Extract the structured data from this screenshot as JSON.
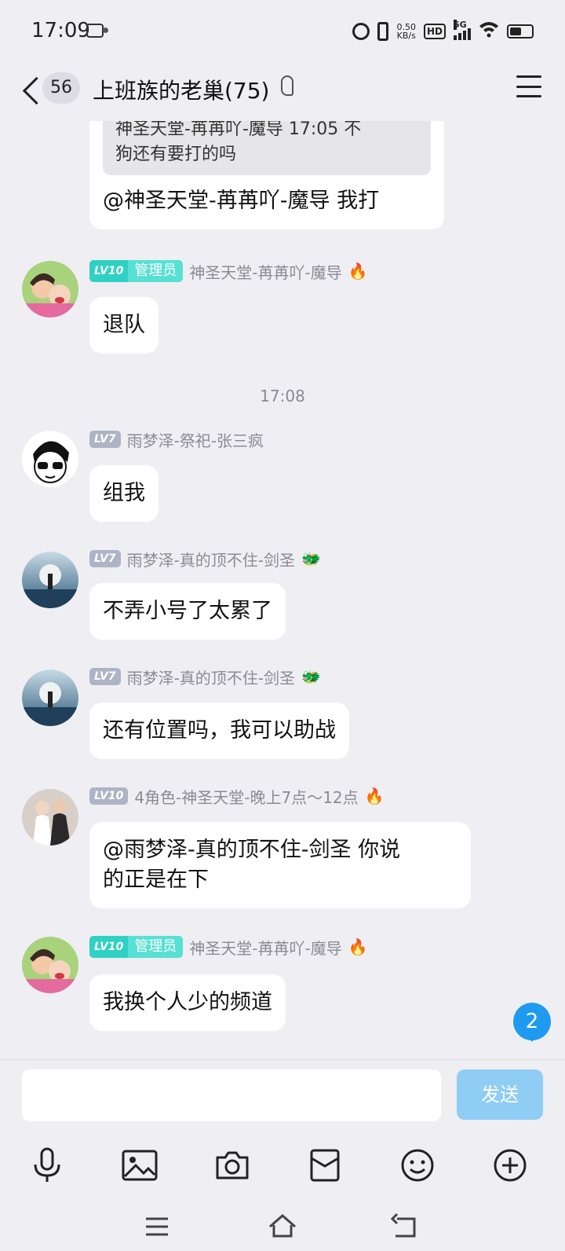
{
  "status": {
    "time": "17:09",
    "net_speed": "0.50",
    "net_unit": "KB/s",
    "hd": "HD",
    "gen": "5G"
  },
  "header": {
    "unread": "56",
    "title": "上班族的老巢(75)"
  },
  "messages": {
    "m0": {
      "quote_line1": "神圣天堂-苒苒吖-魔导 17:05 不",
      "quote_line2": "狗还有要打的吗",
      "text": "@神圣天堂-苒苒吖-魔导 我打"
    },
    "m1": {
      "lv": "LV10",
      "role": "管理员",
      "name": "神圣天堂-苒苒吖-魔导",
      "text": "退队"
    },
    "timestamp": "17:08",
    "m2": {
      "lv": "LV7",
      "name": "雨梦泽-祭祀-张三疯",
      "text": "组我"
    },
    "m3": {
      "lv": "LV7",
      "name": "雨梦泽-真的顶不住-剑圣",
      "text": "不弄小号了太累了"
    },
    "m4": {
      "lv": "LV7",
      "name": "雨梦泽-真的顶不住-剑圣",
      "text": "还有位置吗，我可以助战"
    },
    "m5": {
      "lv": "LV10",
      "name": "4角色-神圣天堂-晚上7点～12点",
      "text_line1": "@雨梦泽-真的顶不住-剑圣 你说",
      "text_line2": "的正是在下"
    },
    "m6": {
      "lv": "LV10",
      "role": "管理员",
      "name": "神圣天堂-苒苒吖-魔导",
      "text": "我换个人少的频道"
    }
  },
  "new_messages_badge": "2",
  "input": {
    "placeholder": "",
    "send_label": "发送"
  },
  "icons": [
    "voice-icon",
    "image-icon",
    "camera-icon",
    "red-packet-icon",
    "emoji-icon",
    "plus-icon"
  ],
  "colors": {
    "background": "#efeff3",
    "admin_badge": "#2fd1c4",
    "level_badge": "#aeb4c6",
    "send_button": "#8fcdf5",
    "new_badge": "#1e9bf0"
  }
}
